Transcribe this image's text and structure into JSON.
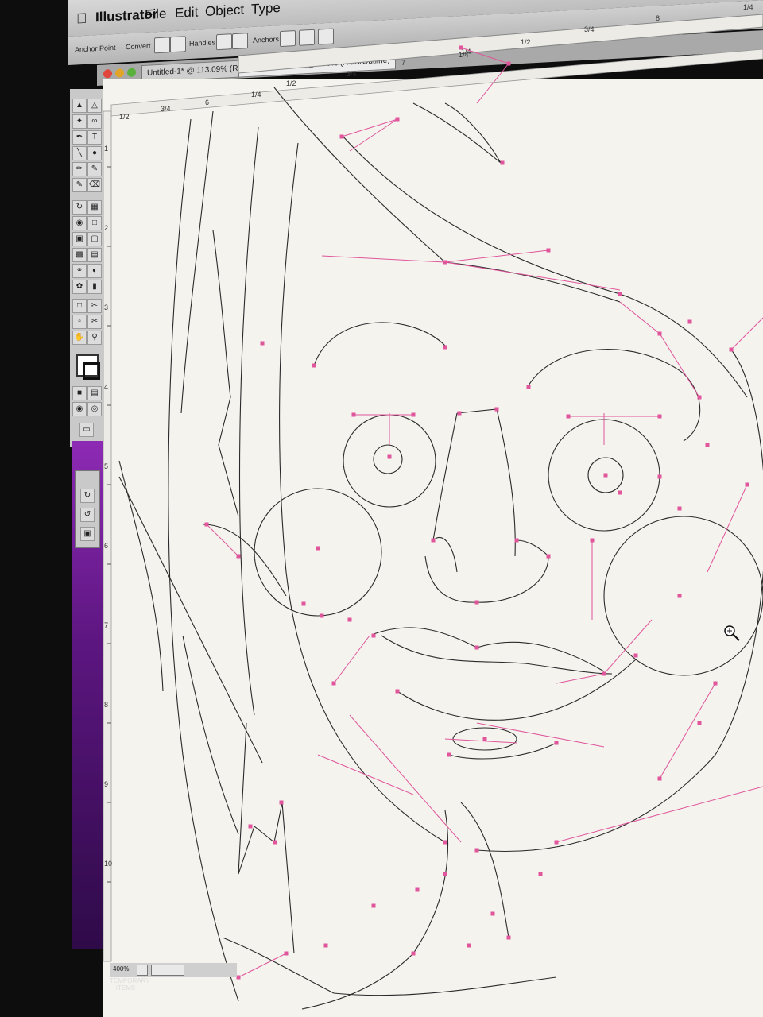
{
  "menubar": {
    "app": "Illustrator",
    "file": "File",
    "edit": "Edit",
    "object": "Object",
    "type": "Type"
  },
  "control": {
    "anchor_point": "Anchor Point",
    "convert": "Convert",
    "handles": "Handles",
    "anchors": "Anchors"
  },
  "tabs": [
    {
      "label": "Untitled-1* @ 113.09% (RGB/Preview)"
    },
    {
      "label": "BIGBANG2.ai* @ 400% (RGB/Outline)"
    }
  ],
  "ruler": {
    "top": [
      "1/4",
      "1/2",
      "3/4",
      "8",
      "1/4"
    ],
    "doc": [
      "1/4",
      "3/4",
      "7",
      "1/4",
      "1/2",
      "6",
      "3/4",
      "1/2"
    ],
    "left": [
      "1",
      "2",
      "3",
      "4",
      "5",
      "6",
      "7",
      "8",
      "9",
      "10"
    ]
  },
  "status": {
    "zoom": "400%"
  },
  "trash": {
    "label": "TEMPORARY ITEMS"
  },
  "colors": {
    "path": "#222222",
    "handle": "#e0559b",
    "canvas": "#f4f3ee",
    "dock": "#7a1fa0"
  },
  "icons": [
    "apple-icon",
    "selection-tool-icon",
    "direct-selection-icon",
    "pen-tool-icon",
    "type-tool-icon",
    "line-tool-icon",
    "ellipse-tool-icon",
    "brush-tool-icon",
    "pencil-tool-icon",
    "eraser-icon",
    "rotate-tool-icon",
    "scale-tool-icon",
    "hand-tool-icon",
    "zoom-tool-icon",
    "fill-stroke-icon",
    "zoom-cursor-icon"
  ]
}
